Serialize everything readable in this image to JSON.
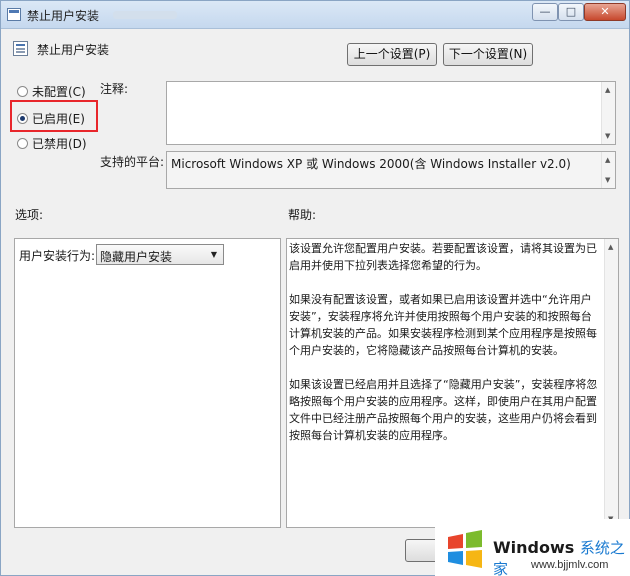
{
  "window": {
    "title": "禁止用户安装",
    "controls": {
      "minimize": "—",
      "maximize": "□",
      "close": "✕"
    }
  },
  "header": {
    "setting_title": "禁止用户安装",
    "prev_button": "上一个设置(P)",
    "next_button": "下一个设置(N)"
  },
  "state_options": [
    {
      "label": "未配置(C)",
      "selected": false
    },
    {
      "label": "已启用(E)",
      "selected": true
    },
    {
      "label": "已禁用(D)",
      "selected": false
    }
  ],
  "comment": {
    "label": "注释:",
    "value": ""
  },
  "platform": {
    "label": "支持的平台:",
    "value": "Microsoft Windows XP 或 Windows 2000(含 Windows Installer v2.0)"
  },
  "options": {
    "label": "选项:",
    "install_behavior_label": "用户安装行为:",
    "install_behavior_value": "隐藏用户安装"
  },
  "help": {
    "label": "帮助:",
    "paragraphs": [
      "该设置允许您配置用户安装。若要配置该设置，请将其设置为已启用并使用下拉列表选择您希望的行为。",
      "如果没有配置该设置，或者如果已启用该设置并选中“允许用户安装”，安装程序将允许并使用按照每个用户安装的和按照每台计算机安装的产品。如果安装程序检测到某个应用程序是按照每个用户安装的，它将隐藏该产品按照每台计算机的安装。",
      "如果该设置已经启用并且选择了“隐藏用户安装”，安装程序将忽略按照每个用户安装的应用程序。这样，即使用户在其用户配置文件中已经注册产品按照每个用户的安装，这些用户仍将会看到按照每台计算机安装的应用程序。"
    ]
  },
  "footer": {
    "ok_button": "确"
  },
  "watermark": {
    "brand": "Windows",
    "brand_cn": "系统之家",
    "url": "www.bjjmlv.com"
  },
  "colors": {
    "highlight_box": "#e8262b",
    "title_bar": "#c5d8ee"
  }
}
